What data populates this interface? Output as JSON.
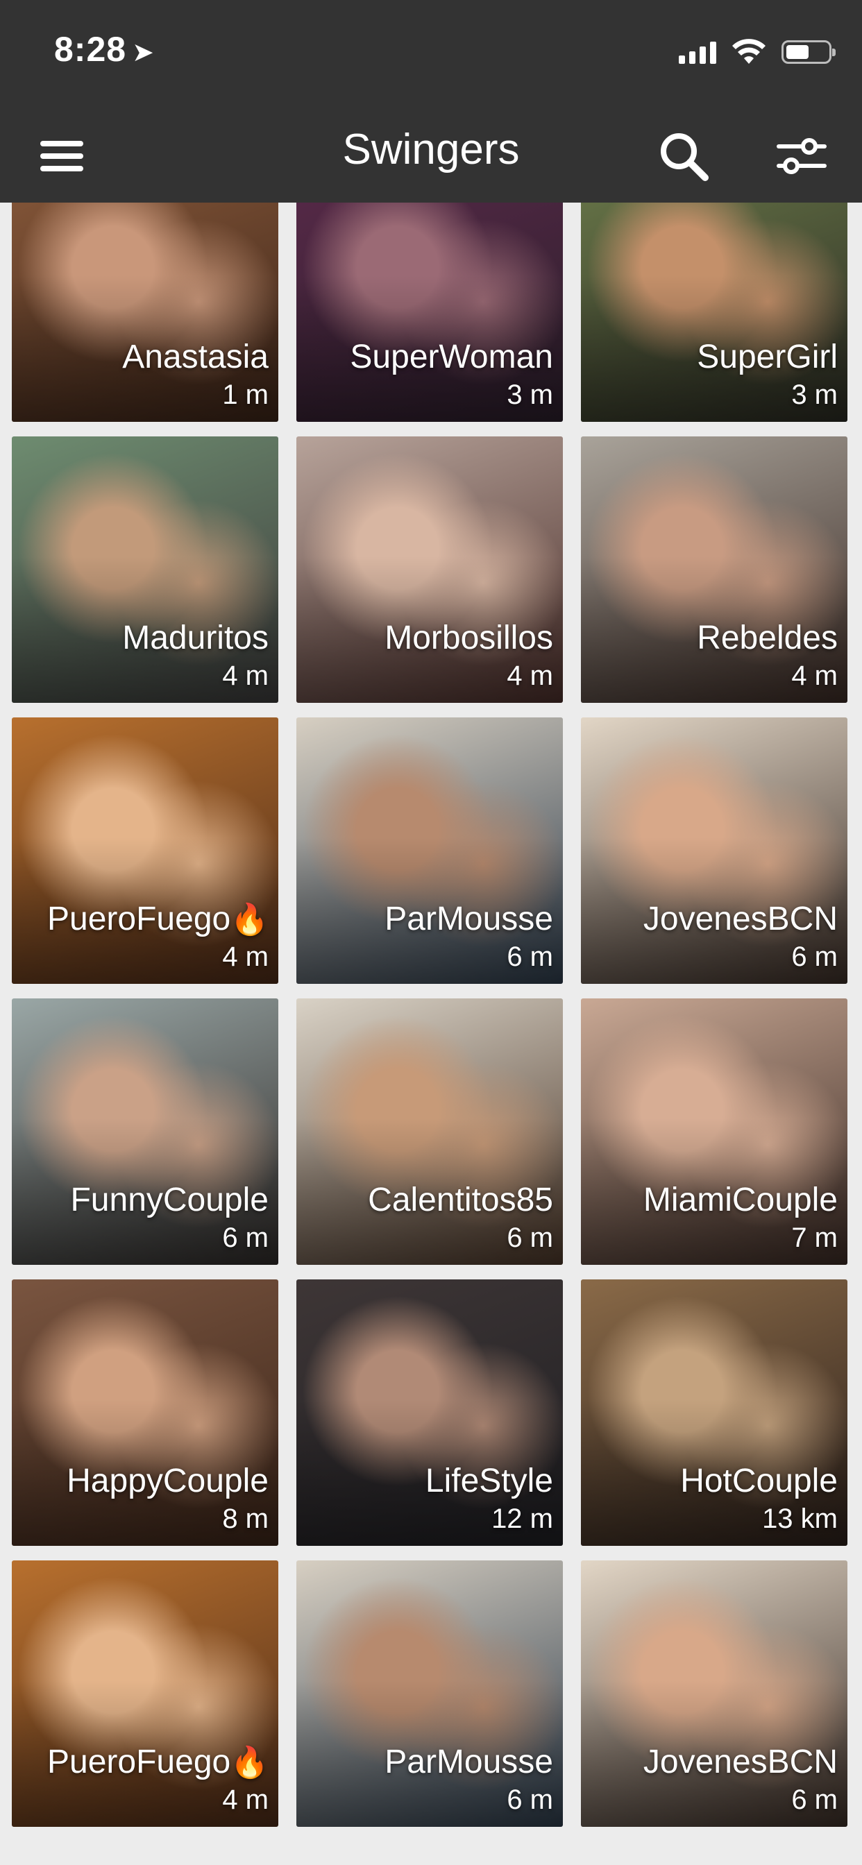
{
  "status_bar": {
    "time": "8:28",
    "location_icon": "location-arrow-icon",
    "signal_icon": "cellular-signal-icon",
    "wifi_icon": "wifi-icon",
    "battery_icon": "battery-icon",
    "battery_level": 0.55
  },
  "header": {
    "title": "Swingers",
    "menu_icon": "hamburger-menu-icon",
    "search_icon": "search-icon",
    "filter_icon": "sliders-filter-icon",
    "background": "#333333"
  },
  "profiles": [
    {
      "name": "Anastasia",
      "distance": "1 m",
      "colors": [
        "#8a5a3b",
        "#c9977a",
        "#3b2418"
      ]
    },
    {
      "name": "SuperWoman",
      "distance": "3 m",
      "colors": [
        "#5a2a4a",
        "#9b6a75",
        "#2a1e2a"
      ]
    },
    {
      "name": "SuperGirl",
      "distance": "3 m",
      "colors": [
        "#6b7a4a",
        "#c4906a",
        "#2a2a22"
      ]
    },
    {
      "name": "Maduritos",
      "distance": "4 m",
      "colors": [
        "#6e8c70",
        "#c29a7a",
        "#3b3a3a"
      ]
    },
    {
      "name": "Morbosillos",
      "distance": "4 m",
      "colors": [
        "#b7a39a",
        "#d8b6a2",
        "#4a2e2a"
      ]
    },
    {
      "name": "Rebeldes",
      "distance": "4 m",
      "colors": [
        "#a9a39a",
        "#c89b82",
        "#3a2a24"
      ]
    },
    {
      "name": "PueroFuego",
      "distance": "4 m",
      "flame": "🔥",
      "colors": [
        "#b8702e",
        "#e4b48a",
        "#4a2a18"
      ]
    },
    {
      "name": "ParMousse",
      "distance": "6 m",
      "colors": [
        "#d7cfc2",
        "#b78a6e",
        "#2d3b4a"
      ]
    },
    {
      "name": "JovenesBCN",
      "distance": "6 m",
      "colors": [
        "#e2d6c6",
        "#d8a889",
        "#3a2d26"
      ]
    },
    {
      "name": "FunnyCouple",
      "distance": "6 m",
      "colors": [
        "#9aa7a6",
        "#caa187",
        "#2e2a28"
      ]
    },
    {
      "name": "Calentitos85",
      "distance": "6 m",
      "colors": [
        "#d9d2c6",
        "#c79a78",
        "#4a3628"
      ]
    },
    {
      "name": "MiamiCouple",
      "distance": "7 m",
      "colors": [
        "#c9a894",
        "#d7ad94",
        "#3a2a24"
      ]
    },
    {
      "name": "HappyCouple",
      "distance": "8 m",
      "colors": [
        "#7a5540",
        "#d0a080",
        "#3a2418"
      ]
    },
    {
      "name": "LifeStyle",
      "distance": "12 m",
      "colors": [
        "#3e3636",
        "#b18a76",
        "#1e1e22"
      ]
    },
    {
      "name": "HotCouple",
      "distance": "13 km",
      "colors": [
        "#8a6a48",
        "#c4a27e",
        "#2a1f1a"
      ]
    },
    {
      "name": "PueroFuego",
      "distance": "4 m",
      "flame": "🔥",
      "colors": [
        "#b8702e",
        "#e4b48a",
        "#4a2a18"
      ]
    },
    {
      "name": "ParMousse",
      "distance": "6 m",
      "colors": [
        "#d7cfc2",
        "#b78a6e",
        "#2d3b4a"
      ]
    },
    {
      "name": "JovenesBCN",
      "distance": "6 m",
      "colors": [
        "#e2d6c6",
        "#d8a889",
        "#3a2d26"
      ]
    }
  ]
}
